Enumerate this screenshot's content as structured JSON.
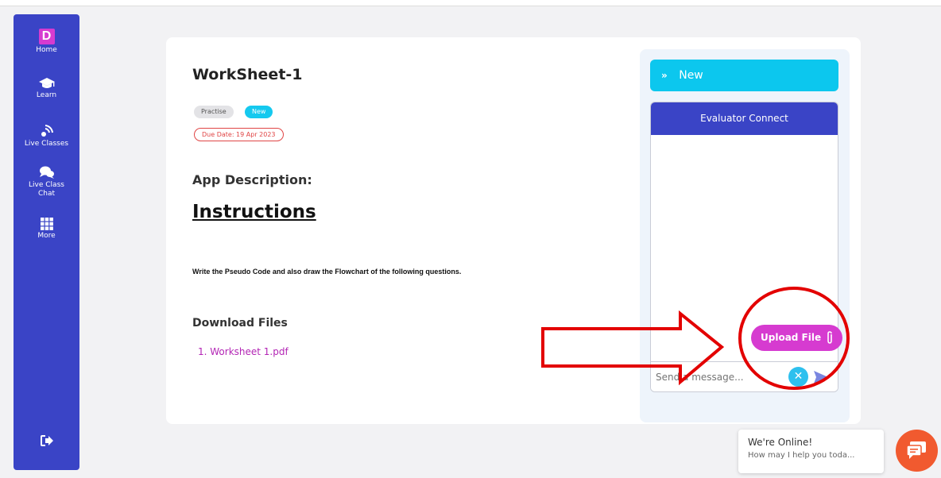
{
  "sidebar": {
    "logo_letter": "D",
    "items": [
      {
        "label": "Home",
        "icon": "logo-d-icon"
      },
      {
        "label": "Learn",
        "icon": "graduation-cap-icon"
      },
      {
        "label": "Live Classes",
        "icon": "broadcast-icon"
      },
      {
        "label": "Live Class Chat",
        "icon": "chat-bubbles-icon"
      },
      {
        "label": "More",
        "icon": "grid-icon"
      }
    ],
    "logout_icon": "logout-icon"
  },
  "worksheet": {
    "title": "WorkSheet-1",
    "tags": [
      "Practise",
      "New"
    ],
    "due_date": "Due Date: 19 Apr 2023",
    "app_description_heading": "App Description:",
    "instructions_heading": "Instructions",
    "question": "Write the Pseudo Code and also draw the Flowchart of the following questions.",
    "download_heading": "Download Files",
    "files": [
      "1. Worksheet 1.pdf"
    ]
  },
  "panel": {
    "status_label": "New",
    "chat_title": "Evaluator Connect",
    "message_placeholder": "Send a message...",
    "upload_label": "Upload File"
  },
  "widget": {
    "title": "We're Online!",
    "subtitle": "How may I help you toda..."
  },
  "colors": {
    "sidebar": "#3a44c6",
    "accent_cyan": "#0cc7ee",
    "accent_magenta": "#d63bd0",
    "annotation_red": "#e30000",
    "widget_orange": "#f15a2f"
  }
}
